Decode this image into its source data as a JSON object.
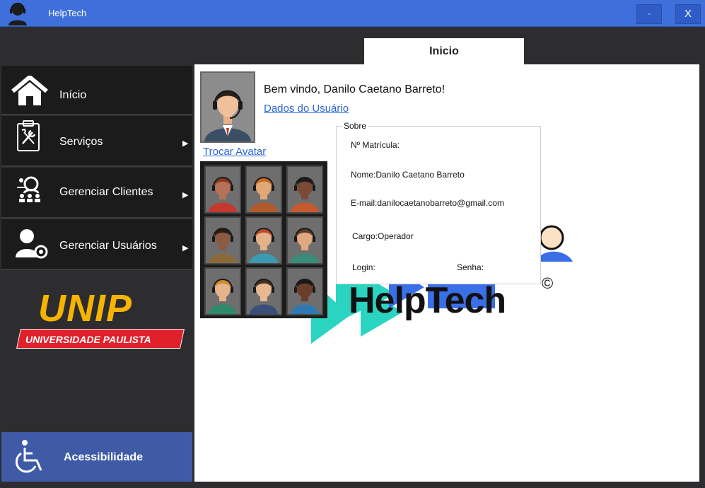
{
  "window": {
    "title": "HelpTech",
    "minimize_label": "-",
    "close_label": "X"
  },
  "tabs": [
    "Inicio"
  ],
  "sidebar": {
    "items": [
      {
        "label": "Início",
        "icon": "home-icon"
      },
      {
        "label": "Serviços",
        "icon": "tools-clipboard-icon",
        "arrow": "▶"
      },
      {
        "label": "Gerenciar Clientes",
        "icon": "clients-group-icon",
        "arrow": "▶"
      },
      {
        "label": "Gerenciar Usuários",
        "icon": "user-settings-icon",
        "arrow": "▶"
      }
    ],
    "logo": {
      "word": "UNIP",
      "subtitle": "UNIVERSIDADE PAULISTA"
    },
    "accessibility": {
      "label": "Acessibilidade",
      "icon": "wheelchair-icon"
    }
  },
  "main": {
    "welcome": "Bem vindo, Danilo Caetano Barreto!",
    "user_data_link": "Dados do Usuário",
    "change_avatar_link": "Trocar Avatar",
    "hero_text": "HelpTech",
    "hero_copyright": "©",
    "sobre": {
      "legend": "Sobre",
      "matricula": "Nº Matrícula:",
      "nome": "Nome:Danilo Caetano Barreto",
      "email": "E-mail:danilocaetanobarreto@gmail.com",
      "cargo": "Cargo:Operador",
      "login": "Login:",
      "senha": "Senha:"
    }
  },
  "colors": {
    "titlebar": "#3f6fdb",
    "accessibility_bg": "#3f5ba8",
    "link": "#2a66d6",
    "unip_yellow": "#f5b400",
    "unip_red": "#e0212b",
    "hero_cyan": "#2ad4c0",
    "hero_blue": "#3b6fe8"
  },
  "avatars": [
    {
      "skin": "#b5715a",
      "hair": "#8b3a1a",
      "shirt": "#c4392e"
    },
    {
      "skin": "#e0a874",
      "hair": "#c86a22",
      "shirt": "#b25a2a"
    },
    {
      "skin": "#7a4a36",
      "hair": "#1c1c1c",
      "shirt": "#c55a2e"
    },
    {
      "skin": "#8a5a42",
      "hair": "#2a1c14",
      "shirt": "#8a6a3a"
    },
    {
      "skin": "#e6b08a",
      "hair": "#b84a2a",
      "shirt": "#3d9ab0"
    },
    {
      "skin": "#e0a880",
      "hair": "#5a3a2a",
      "shirt": "#3a8c7a"
    },
    {
      "skin": "#e6b48a",
      "hair": "#d08a2a",
      "shirt": "#2e8a6c"
    },
    {
      "skin": "#e8b890",
      "hair": "#4a3020",
      "shirt": "#3a4e7a"
    },
    {
      "skin": "#6a3e2a",
      "hair": "#1a1a1a",
      "shirt": "#2e7ab0"
    }
  ]
}
